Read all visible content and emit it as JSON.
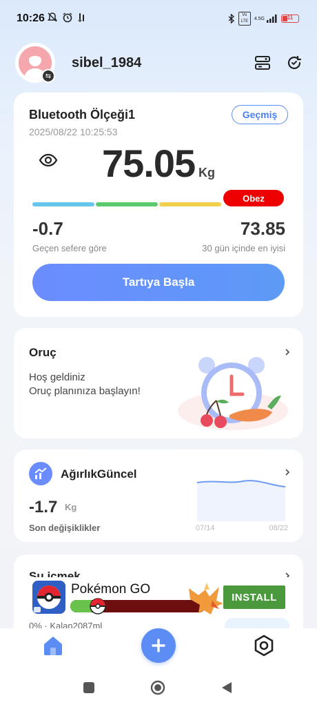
{
  "status_bar": {
    "time": "10:26",
    "network_badge_1": "Vo LTE",
    "network_badge_2": "4.5G",
    "battery_level": "11"
  },
  "header": {
    "username": "sibel_1984"
  },
  "scale_card": {
    "device_name": "Bluetooth Ölçeği1",
    "date": "2025/08/22 10:25:53",
    "history_label": "Geçmiş",
    "weight": "75.05",
    "unit": "Kg",
    "status_label": "Obez",
    "bar_colors": [
      "#64c6ee",
      "#5bc96d",
      "#f2cf4a",
      "#e60000"
    ],
    "change_value": "-0.7",
    "change_label": "Geçen sefere göre",
    "best_value": "73.85",
    "best_label": "30 gün içinde en iyisi",
    "start_button": "Tartıya Başla"
  },
  "fasting_card": {
    "title": "Oruç",
    "line1": "Hoş geldiniz",
    "line2": "Oruç planınıza başlayın!"
  },
  "weight_card": {
    "title": "AğırlıkGüncel",
    "change": "-1.7",
    "unit": "Kg",
    "subtitle": "Son değişiklikler",
    "date_start": "07/14",
    "date_end": "08/22"
  },
  "water_card": {
    "title": "Su içmek",
    "status": "0% · Kalan2087ml"
  },
  "ad": {
    "app_name": "Pokémon GO",
    "install_label": "INSTALL",
    "progress": 0.16
  },
  "colors": {
    "accent": "#5b8df5",
    "danger": "#e60000"
  }
}
